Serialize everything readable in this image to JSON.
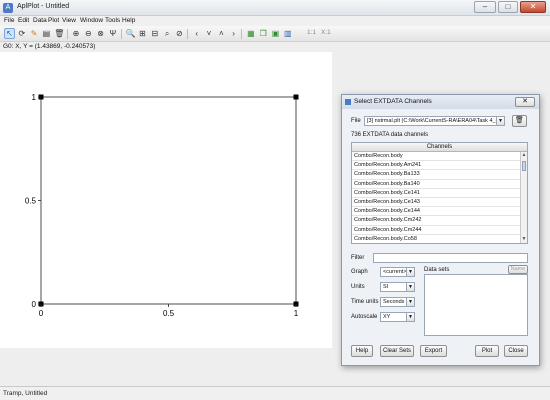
{
  "window": {
    "title": "AplPlot - Untitled",
    "app_icon": "A",
    "controls": {
      "minimize": "–",
      "maximize": "□",
      "close": "✕"
    }
  },
  "menu": {
    "items": [
      {
        "key": "file",
        "label": "File"
      },
      {
        "key": "edit",
        "label": "Edit"
      },
      {
        "key": "data",
        "label": "Data"
      },
      {
        "key": "plot",
        "label": "Plot"
      },
      {
        "key": "view",
        "label": "View"
      },
      {
        "key": "window",
        "label": "Window"
      },
      {
        "key": "tools",
        "label": "Tools"
      },
      {
        "key": "help",
        "label": "Help"
      }
    ]
  },
  "toolbar": {
    "buttons": [
      {
        "name": "select-pointer-icon",
        "glyph": "↖",
        "active": true,
        "color": "blue"
      },
      {
        "name": "rotate-icon",
        "glyph": "⟳",
        "active": false,
        "color": ""
      },
      {
        "name": "pencil-icon",
        "glyph": "✎",
        "active": false,
        "color": "orange"
      },
      {
        "name": "table-icon",
        "glyph": "▤",
        "active": false,
        "color": ""
      },
      {
        "name": "trash-icon",
        "glyph": "🗑",
        "active": false,
        "color": ""
      },
      {
        "sep": true
      },
      {
        "name": "crosshair-icon",
        "glyph": "⊕",
        "active": false,
        "color": ""
      },
      {
        "name": "fit-icon",
        "glyph": "⊖",
        "active": false,
        "color": ""
      },
      {
        "name": "reset-icon",
        "glyph": "⊗",
        "active": false,
        "color": ""
      },
      {
        "name": "fork-icon",
        "glyph": "Ψ",
        "active": false,
        "color": ""
      },
      {
        "sep": true
      },
      {
        "name": "zoom-icon",
        "glyph": "🔍",
        "active": false,
        "color": ""
      },
      {
        "name": "zoom-in-icon",
        "glyph": "⊞",
        "active": false,
        "color": ""
      },
      {
        "name": "zoom-out-icon",
        "glyph": "⊟",
        "active": false,
        "color": ""
      },
      {
        "name": "zoom-x-icon",
        "glyph": "⌕",
        "active": false,
        "color": ""
      },
      {
        "name": "zoom-reset-icon",
        "glyph": "⊘",
        "active": false,
        "color": ""
      },
      {
        "sep": true
      },
      {
        "name": "pan-left-icon",
        "glyph": "‹",
        "active": false,
        "color": ""
      },
      {
        "name": "pan-down-icon",
        "glyph": "˅",
        "active": false,
        "color": ""
      },
      {
        "name": "pan-up-icon",
        "glyph": "˄",
        "active": false,
        "color": ""
      },
      {
        "name": "pan-right-icon",
        "glyph": "›",
        "active": false,
        "color": ""
      },
      {
        "sep": true
      },
      {
        "name": "export-icon",
        "glyph": "▦",
        "active": false,
        "color": "green"
      },
      {
        "name": "copy-icon",
        "glyph": "❐",
        "active": false,
        "color": "green"
      },
      {
        "name": "print-icon",
        "glyph": "▣",
        "active": false,
        "color": "green"
      },
      {
        "name": "save-icon",
        "glyph": "▥",
        "active": false,
        "color": "blue"
      }
    ],
    "scale_readout": "1:1",
    "zoom_readout": "X:1"
  },
  "coords": {
    "text": "G0: X, Y = (1.43869, -0.240573)"
  },
  "plot": {
    "x_ticks": [
      "0",
      "0.5",
      "1"
    ],
    "y_ticks": [
      "0",
      "0.5",
      "1"
    ]
  },
  "status": {
    "text": "Tramp, Untitled"
  },
  "dialog": {
    "title": "Select EXTDATA Channels",
    "close": "✕",
    "file_label": "File",
    "file_value": "[3] nstrmal.plt (C:\\Work\\CurrentS-RA\\ERA04\\Task 4_d...",
    "channel_count": "736 EXTDATA data channels",
    "channels_header": "Channels",
    "channels": [
      "Combo/Recon.body",
      "Combo/Recon.body.Am241",
      "Combo/Recon.body.Ba133",
      "Combo/Recon.body.Ba140",
      "Combo/Recon.body.Ce141",
      "Combo/Recon.body.Ce143",
      "Combo/Recon.body.Ce144",
      "Combo/Recon.body.Cm242",
      "Combo/Recon.body.Cm244",
      "Combo/Recon.body.Co58"
    ],
    "filter_label": "Filter",
    "filter_value": "",
    "graph_label": "Graph",
    "graph_value": "<current>",
    "units_label": "Units",
    "units_value": "SI",
    "time_units_label": "Time units",
    "time_units_value": "Seconds",
    "autoscale_label": "Autoscale",
    "autoscale_value": "XY",
    "datasets_label": "Data sets",
    "name_button": "Name",
    "buttons": {
      "help": "Help",
      "clear_sets": "Clear Sets",
      "export": "Export",
      "plot": "Plot",
      "close": "Close"
    }
  }
}
